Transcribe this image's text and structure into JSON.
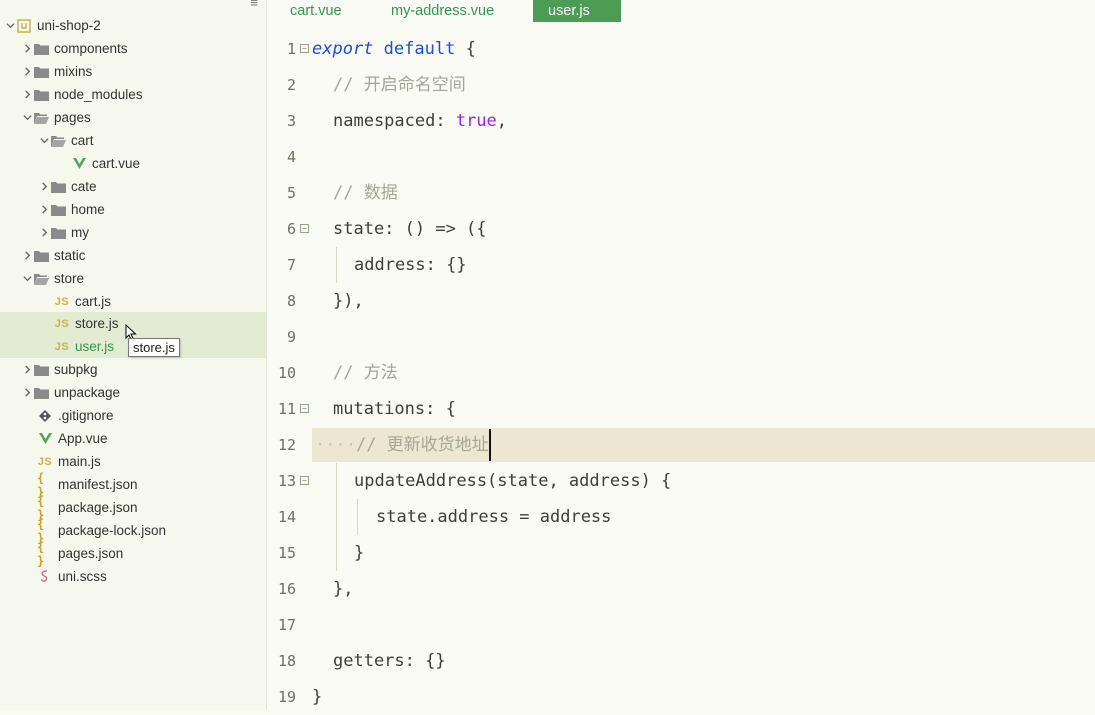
{
  "sidebar": {
    "root": "uni-shop-2",
    "items": [
      {
        "label": "components"
      },
      {
        "label": "mixins"
      },
      {
        "label": "node_modules"
      },
      {
        "label": "pages"
      },
      {
        "label": "cart"
      },
      {
        "label": "cart.vue"
      },
      {
        "label": "cate"
      },
      {
        "label": "home"
      },
      {
        "label": "my"
      },
      {
        "label": "static"
      },
      {
        "label": "store"
      },
      {
        "label": "cart.js"
      },
      {
        "label": "store.js"
      },
      {
        "label": "user.js"
      },
      {
        "label": "subpkg"
      },
      {
        "label": "unpackage"
      },
      {
        "label": ".gitignore"
      },
      {
        "label": "App.vue"
      },
      {
        "label": "main.js"
      },
      {
        "label": "manifest.json"
      },
      {
        "label": "package.json"
      },
      {
        "label": "package-lock.json"
      },
      {
        "label": "pages.json"
      },
      {
        "label": "uni.scss"
      }
    ],
    "tooltip": "store.js",
    "js_badge": "JS",
    "json_badge": "{ }"
  },
  "tabs": [
    {
      "label": "cart.vue"
    },
    {
      "label": "my-address.vue"
    },
    {
      "label": "user.js",
      "active": true
    }
  ],
  "editor": {
    "line_numbers": [
      "1",
      "2",
      "3",
      "4",
      "5",
      "6",
      "7",
      "8",
      "9",
      "10",
      "11",
      "12",
      "13",
      "14",
      "15",
      "16",
      "17",
      "18",
      "19"
    ],
    "tokens": {
      "l1_kw": "export",
      "l1_kw2": "default",
      "l1_rest": " {",
      "l2_cm": "// 开启命名空间",
      "l3_key": "namespaced: ",
      "l3_bool": "true",
      "l3_end": ",",
      "l5_cm": "// 数据",
      "l6": "state: () => ({",
      "l7": "address: {}",
      "l8": "}),",
      "l10_cm": "// 方法",
      "l11": "mutations: {",
      "l12_dots": "····",
      "l12_cm": "// 更新收货地址",
      "l13": "updateAddress(state, address) {",
      "l14": "state.address = address",
      "l15": "}",
      "l16": "},",
      "l18": "getters: {}",
      "l19": "}"
    },
    "fold_glyph": "−"
  },
  "colors": {
    "keyword": "#1a4fd6",
    "boolean": "#a020f0",
    "comment": "#a4a697",
    "tab_active": "#4c9c55",
    "tab_text": "#2e9a49",
    "folder": "#8a8a8a",
    "vue": "#4fa558"
  }
}
